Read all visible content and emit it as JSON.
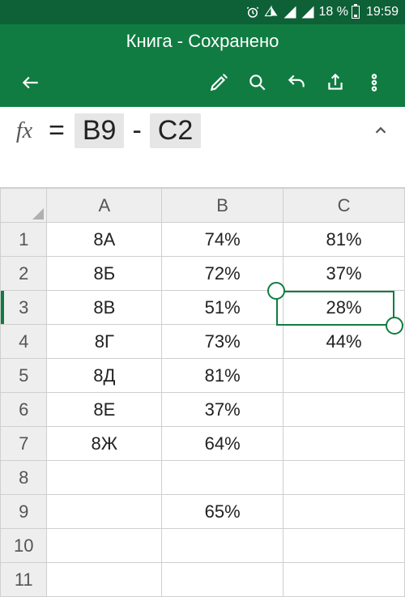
{
  "status": {
    "battery": "18 %",
    "time": "19:59"
  },
  "title": "Книга - Сохранено",
  "formula": {
    "eq": "=",
    "ref1": "B9",
    "op": "-",
    "ref2": "C2"
  },
  "cols": [
    "A",
    "B",
    "C"
  ],
  "rows": [
    "1",
    "2",
    "3",
    "4",
    "5",
    "6",
    "7",
    "8",
    "9",
    "10",
    "11"
  ],
  "cells": {
    "A1": "8А",
    "B1": "74%",
    "C1": "81%",
    "A2": "8Б",
    "B2": "72%",
    "C2": "37%",
    "A3": "8В",
    "B3": "51%",
    "C3": "28%",
    "A4": "8Г",
    "B4": "73%",
    "C4": "44%",
    "A5": "8Д",
    "B5": "81%",
    "A6": "8Е",
    "B6": "37%",
    "A7": "8Ж",
    "B7": "64%",
    "B9": "65%"
  }
}
